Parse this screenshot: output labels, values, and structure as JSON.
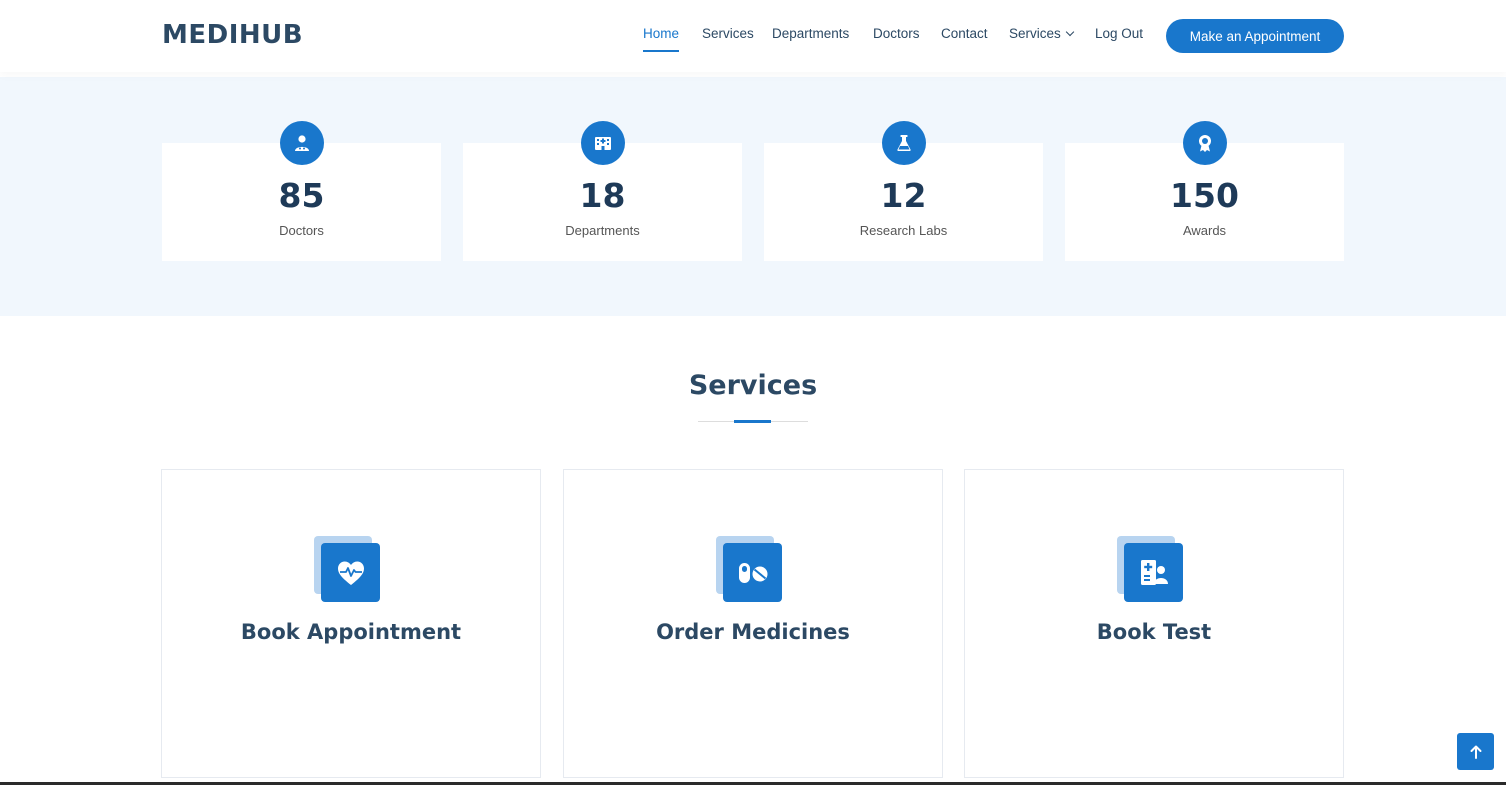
{
  "brand": {
    "logo": "MEDIHUB"
  },
  "nav": {
    "items": [
      {
        "label": "Home",
        "active": true
      },
      {
        "label": "Services"
      },
      {
        "label": "Departments"
      },
      {
        "label": "Doctors"
      },
      {
        "label": "Contact"
      },
      {
        "label": "Services",
        "dropdown": true
      },
      {
        "label": "Log Out"
      }
    ],
    "cta": "Make an Appointment"
  },
  "stats": [
    {
      "value": "85",
      "label": "Doctors",
      "icon": "doctor-icon"
    },
    {
      "value": "18",
      "label": "Departments",
      "icon": "hospital-icon"
    },
    {
      "value": "12",
      "label": "Research Labs",
      "icon": "flask-icon"
    },
    {
      "value": "150",
      "label": "Awards",
      "icon": "award-icon"
    }
  ],
  "services_section": {
    "title": "Services",
    "cards": [
      {
        "title": "Book Appointment",
        "icon": "heart-pulse-icon"
      },
      {
        "title": "Order Medicines",
        "icon": "capsule-pill-icon"
      },
      {
        "title": "Book Test",
        "icon": "medical-report-icon"
      }
    ]
  },
  "colors": {
    "accent": "#1977cc",
    "heading": "#2c4964",
    "band": "#f1f7fd"
  }
}
